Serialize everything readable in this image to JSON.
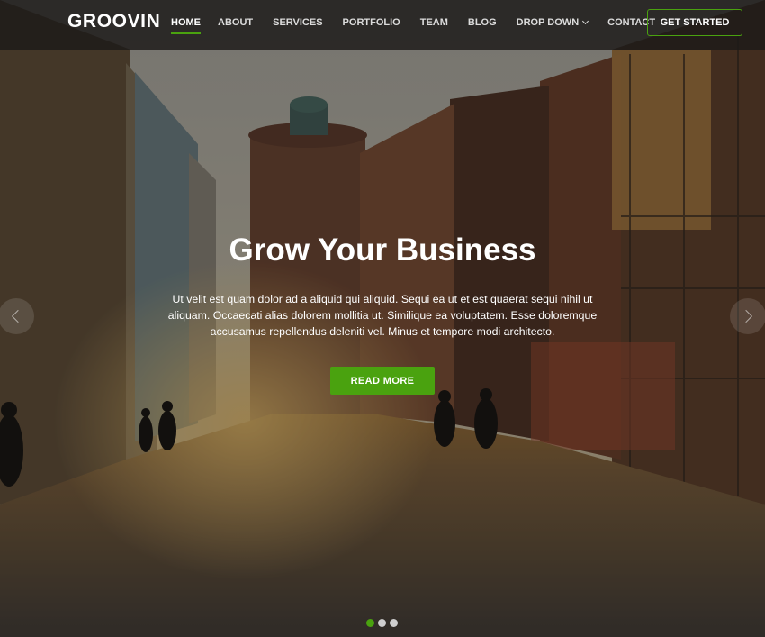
{
  "brand": {
    "name": "GROOVIN"
  },
  "nav": {
    "items": [
      {
        "label": "HOME",
        "active": true
      },
      {
        "label": "ABOUT"
      },
      {
        "label": "SERVICES"
      },
      {
        "label": "PORTFOLIO"
      },
      {
        "label": "TEAM"
      },
      {
        "label": "BLOG"
      },
      {
        "label": "DROP DOWN",
        "has_dropdown": true
      },
      {
        "label": "CONTACT"
      }
    ],
    "cta_label": "GET STARTED"
  },
  "hero": {
    "title": "Grow Your Business",
    "description": "Ut velit est quam dolor ad a aliquid qui aliquid. Sequi ea ut et est quaerat sequi nihil ut aliquam. Occaecati alias dolorem mollitia ut. Similique ea voluptatem. Esse doloremque accusamus repellendus deleniti vel. Minus et tempore modi architecto.",
    "button_label": "READ MORE"
  },
  "carousel": {
    "slide_count": 3,
    "active_slide": 1
  },
  "colors": {
    "accent": "#4aa20f",
    "header_bg": "#1c1a18",
    "text": "#ffffff"
  },
  "icons": {
    "prev": "chevron-left-icon",
    "next": "chevron-right-icon",
    "dropdown": "chevron-down-icon"
  }
}
